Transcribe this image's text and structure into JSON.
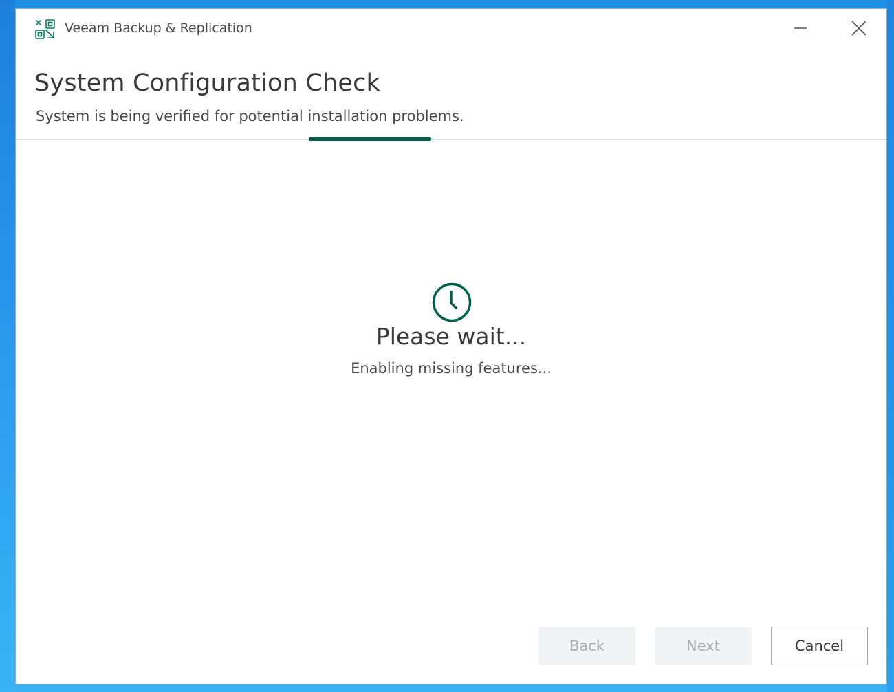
{
  "window": {
    "title": "Veeam Backup & Replication",
    "app_icon": "veeam-logo-icon",
    "controls": {
      "minimize_icon": "minimize-icon",
      "close_icon": "close-icon"
    }
  },
  "header": {
    "title": "System Configuration Check",
    "subtitle": "System is being verified for potential installation problems."
  },
  "status": {
    "icon": "clock-icon",
    "title": "Please wait...",
    "message": "Enabling missing features..."
  },
  "footer": {
    "back_label": "Back",
    "next_label": "Next",
    "cancel_label": "Cancel"
  },
  "colors": {
    "accent": "#005f4b",
    "desktop": "#2aa3ee",
    "disabled_text": "#a9adb1"
  }
}
